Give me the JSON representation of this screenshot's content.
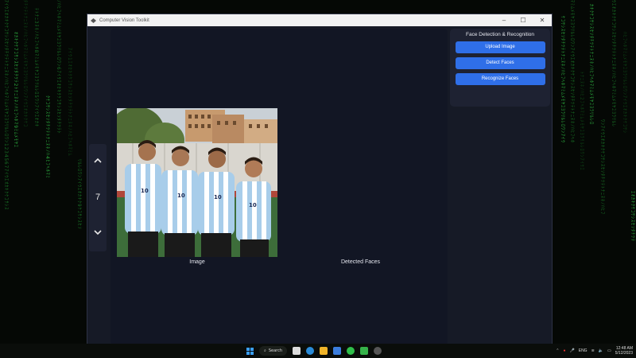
{
  "window": {
    "title": "Computer Vision Toolkit"
  },
  "nav": {
    "page_number": "7"
  },
  "captions": {
    "image": "Image",
    "detected_faces": "Detected Faces"
  },
  "side_panel": {
    "title": "Face Detection & Recognition",
    "buttons": [
      "Upload Image",
      "Detect Faces",
      "Recognize Faces"
    ]
  },
  "taskbar": {
    "search_label": "Search",
    "language": "ENG",
    "time": "12:48 AM",
    "date": "5/12/2023"
  },
  "colors": {
    "accent": "#2f6fe8",
    "window_bg": "#161a26",
    "panel_bg": "#1e2232",
    "matrix_green": "#1d8a2d"
  },
  "icons": [
    "app-icon",
    "minimize-icon",
    "maximize-icon",
    "close-icon",
    "chevron-up-icon",
    "chevron-down-icon",
    "windows-start-icon",
    "search-icon"
  ]
}
